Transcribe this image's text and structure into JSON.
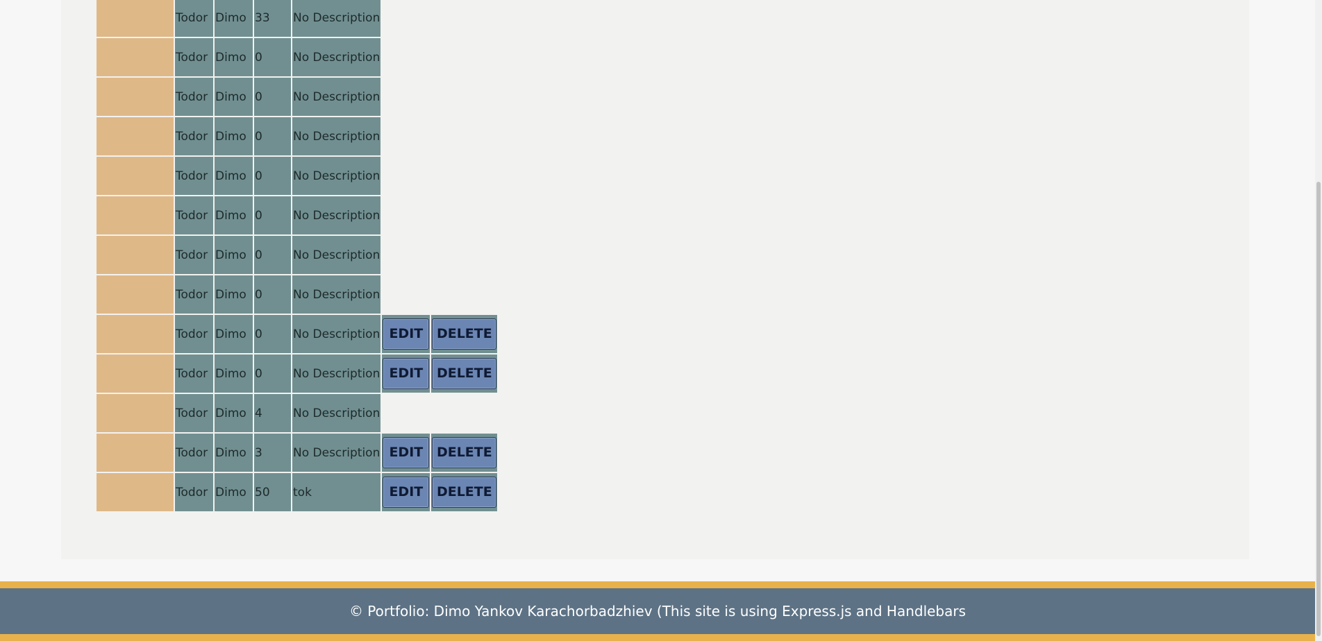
{
  "table": {
    "rows": [
      {
        "user": "Todor",
        "name": "Dimo",
        "score": "33",
        "description": "No Description",
        "actions": false
      },
      {
        "user": "Todor",
        "name": "Dimo",
        "score": "0",
        "description": "No Description",
        "actions": false
      },
      {
        "user": "Todor",
        "name": "Dimo",
        "score": "0",
        "description": "No Description",
        "actions": false
      },
      {
        "user": "Todor",
        "name": "Dimo",
        "score": "0",
        "description": "No Description",
        "actions": false
      },
      {
        "user": "Todor",
        "name": "Dimo",
        "score": "0",
        "description": "No Description",
        "actions": false
      },
      {
        "user": "Todor",
        "name": "Dimo",
        "score": "0",
        "description": "No Description",
        "actions": false
      },
      {
        "user": "Todor",
        "name": "Dimo",
        "score": "0",
        "description": "No Description",
        "actions": false
      },
      {
        "user": "Todor",
        "name": "Dimo",
        "score": "0",
        "description": "No Description",
        "actions": false
      },
      {
        "user": "Todor",
        "name": "Dimo",
        "score": "0",
        "description": "No Description",
        "actions": true
      },
      {
        "user": "Todor",
        "name": "Dimo",
        "score": "0",
        "description": "No Description",
        "actions": true
      },
      {
        "user": "Todor",
        "name": "Dimo",
        "score": "4",
        "description": "No Description",
        "actions": false
      },
      {
        "user": "Todor",
        "name": "Dimo",
        "score": "3",
        "description": "No Description",
        "actions": true
      },
      {
        "user": "Todor",
        "name": "Dimo",
        "score": "50",
        "description": "tok",
        "actions": true
      }
    ],
    "edit_label": "EDIT",
    "delete_label": "DELETE"
  },
  "footer": {
    "text": "© Portfolio: Dimo Yankov Karachorbadzhiev (This site is using Express.js and Handlebars"
  },
  "colors": {
    "thumbnail_bg": "#dfb888",
    "cell_bg": "#718f91",
    "button_bg": "#6b86b3",
    "footer_bg": "#5d7285",
    "footer_border": "#e8b14b"
  }
}
